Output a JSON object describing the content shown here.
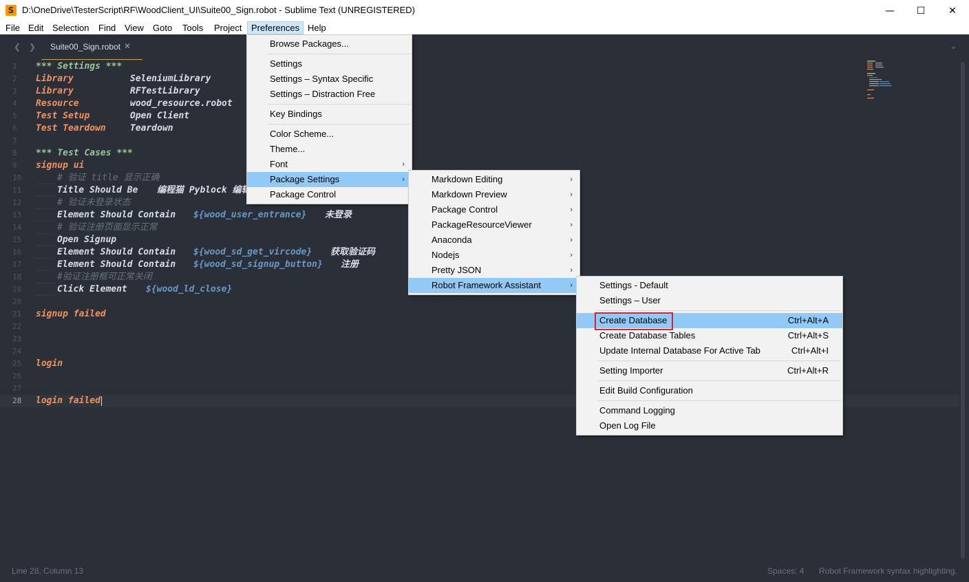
{
  "window": {
    "title": "D:\\OneDrive\\TesterScript\\RF\\WoodClient_UI\\Suite00_Sign.robot - Sublime Text (UNREGISTERED)",
    "app_icon": "S",
    "minimize": "—",
    "maximize": "☐",
    "close": "✕"
  },
  "menubar": [
    "File",
    "Edit",
    "Selection",
    "Find",
    "View",
    "Goto",
    "Tools",
    "Project",
    "Preferences",
    "Help"
  ],
  "tab": {
    "label": "Suite00_Sign.robot",
    "close": "✕",
    "nav_left": "❮",
    "nav_right": "❯",
    "overflow": "⌄"
  },
  "editor": {
    "line_numbers": [
      "1",
      "2",
      "3",
      "4",
      "5",
      "6",
      "7",
      "8",
      "9",
      "10",
      "11",
      "12",
      "13",
      "14",
      "15",
      "16",
      "17",
      "18",
      "19",
      "20",
      "21",
      "22",
      "23",
      "24",
      "25",
      "26",
      "27",
      "28"
    ],
    "current_line": 28,
    "lines": {
      "l1": "*** Settings ***",
      "l2a": "Library",
      "l2b": "SeleniumLibrary",
      "l3a": "Library",
      "l3b": "RFTestLibrary",
      "l4a": "Resource",
      "l4b": "wood_resource.robot",
      "l5a": "Test Setup",
      "l5b": "Open Client",
      "l6a": "Test Teardown",
      "l6b": "Teardown",
      "l8": "*** Test Cases ***",
      "l9": "signup ui",
      "l10": "# 验证 title 显示正确",
      "l11a": "Title Should Be",
      "l11b": "编程猫 Pyblock 编辑",
      "l12": "# 验证未登录状态",
      "l13a": "Element Should Contain",
      "l13b": "${wood_user_entrance}",
      "l13c": "未登录",
      "l14": "# 验证注册页面显示正常",
      "l15": "Open Signup",
      "l16a": "Element Should Contain",
      "l16b": "${wood_sd_get_vircode}",
      "l16c": "获取验证码",
      "l17a": "Element Should Contain",
      "l17b": "${wood_sd_signup_button}",
      "l17c": "注册",
      "l18": "#验证注册框可正常关闭",
      "l19a": "Click Element",
      "l19b": "${wood_ld_close}",
      "l21": "signup failed",
      "l25": "login",
      "l28": "login failed"
    }
  },
  "status": {
    "position": "Line 28, Column 13",
    "spaces": "Spaces: 4",
    "syntax": "Robot Framework syntax highlighting."
  },
  "preferences_menu": {
    "browse_packages": "Browse Packages...",
    "settings": "Settings",
    "settings_syntax": "Settings – Syntax Specific",
    "settings_distraction": "Settings – Distraction Free",
    "key_bindings": "Key Bindings",
    "color_scheme": "Color Scheme...",
    "theme": "Theme...",
    "font": "Font",
    "package_settings": "Package Settings",
    "package_control": "Package Control"
  },
  "package_settings_menu": [
    "Markdown Editing",
    "Markdown Preview",
    "Package Control",
    "PackageResourceViewer",
    "Anaconda",
    "Nodejs",
    "Pretty JSON",
    "Robot Framework Assistant"
  ],
  "rfa_menu": {
    "settings_default": "Settings - Default",
    "settings_user": "Settings – User",
    "create_database": "Create Database",
    "create_database_sc": "Ctrl+Alt+A",
    "create_tables": "Create Database Tables",
    "create_tables_sc": "Ctrl+Alt+S",
    "update_db": "Update Internal Database For Active Tab",
    "update_db_sc": "Ctrl+Alt+I",
    "setting_importer": "Setting Importer",
    "setting_importer_sc": "Ctrl+Alt+R",
    "edit_build": "Edit Build Configuration",
    "command_logging": "Command Logging",
    "open_log": "Open Log File"
  },
  "submenu_arrow": "›"
}
